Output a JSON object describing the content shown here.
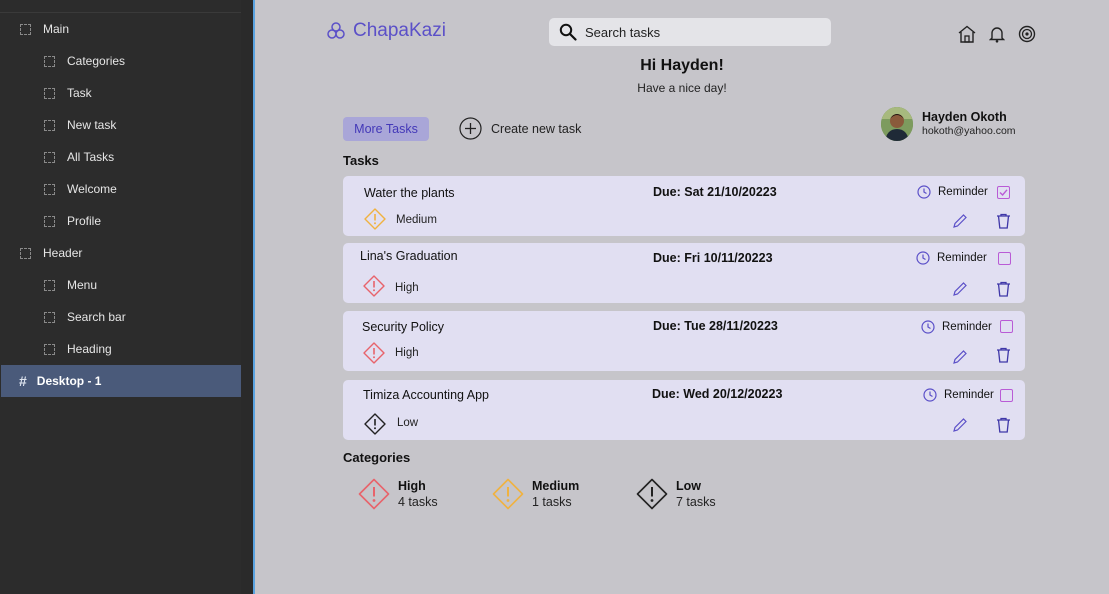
{
  "layers": {
    "items": [
      {
        "label": "Main",
        "level": 0
      },
      {
        "label": "Categories",
        "level": 1
      },
      {
        "label": "Task",
        "level": 1
      },
      {
        "label": "New task",
        "level": 1
      },
      {
        "label": "All Tasks",
        "level": 1
      },
      {
        "label": "Welcome",
        "level": 1
      },
      {
        "label": "Profile",
        "level": 1
      },
      {
        "label": "Header",
        "level": 0
      },
      {
        "label": "Menu",
        "level": 1
      },
      {
        "label": "Search bar",
        "level": 1
      },
      {
        "label": "Heading",
        "level": 1
      },
      {
        "label": "Desktop - 1",
        "level": 0,
        "selected": true
      }
    ]
  },
  "header": {
    "brand": "ChapaKazi",
    "search_placeholder": "Search tasks"
  },
  "welcome": {
    "greeting": "Hi Hayden!",
    "subtitle": "Have a nice day!"
  },
  "actions": {
    "more_label": "More Tasks",
    "create_label": "Create new task"
  },
  "profile": {
    "name": "Hayden Okoth",
    "email": "hokoth@yahoo.com"
  },
  "tasks": {
    "heading": "Tasks",
    "items": [
      {
        "title": "Water the plants",
        "due": "Due: Sat 21/10/20223",
        "priority": "Medium",
        "reminder": "Reminder",
        "checked": true
      },
      {
        "title": "Lina's Graduation",
        "due": "Due: Fri 10/11/20223",
        "priority": "High",
        "reminder": "Reminder",
        "checked": false
      },
      {
        "title": "Security Policy",
        "due": "Due: Tue 28/11/20223",
        "priority": "High",
        "reminder": "Reminder",
        "checked": false
      },
      {
        "title": "Timiza Accounting App",
        "due": "Due: Wed 20/12/20223",
        "priority": "Low",
        "reminder": "Reminder",
        "checked": false
      }
    ]
  },
  "categories": {
    "heading": "Categories",
    "items": [
      {
        "name": "High",
        "count": "4 tasks"
      },
      {
        "name": "Medium",
        "count": "1 tasks"
      },
      {
        "name": "Low",
        "count": "7 tasks"
      }
    ]
  },
  "colors": {
    "accent": "#5b50c8",
    "high": "#e8636b",
    "medium": "#f0b240",
    "low": "#222222",
    "check": "#b95bd6"
  }
}
